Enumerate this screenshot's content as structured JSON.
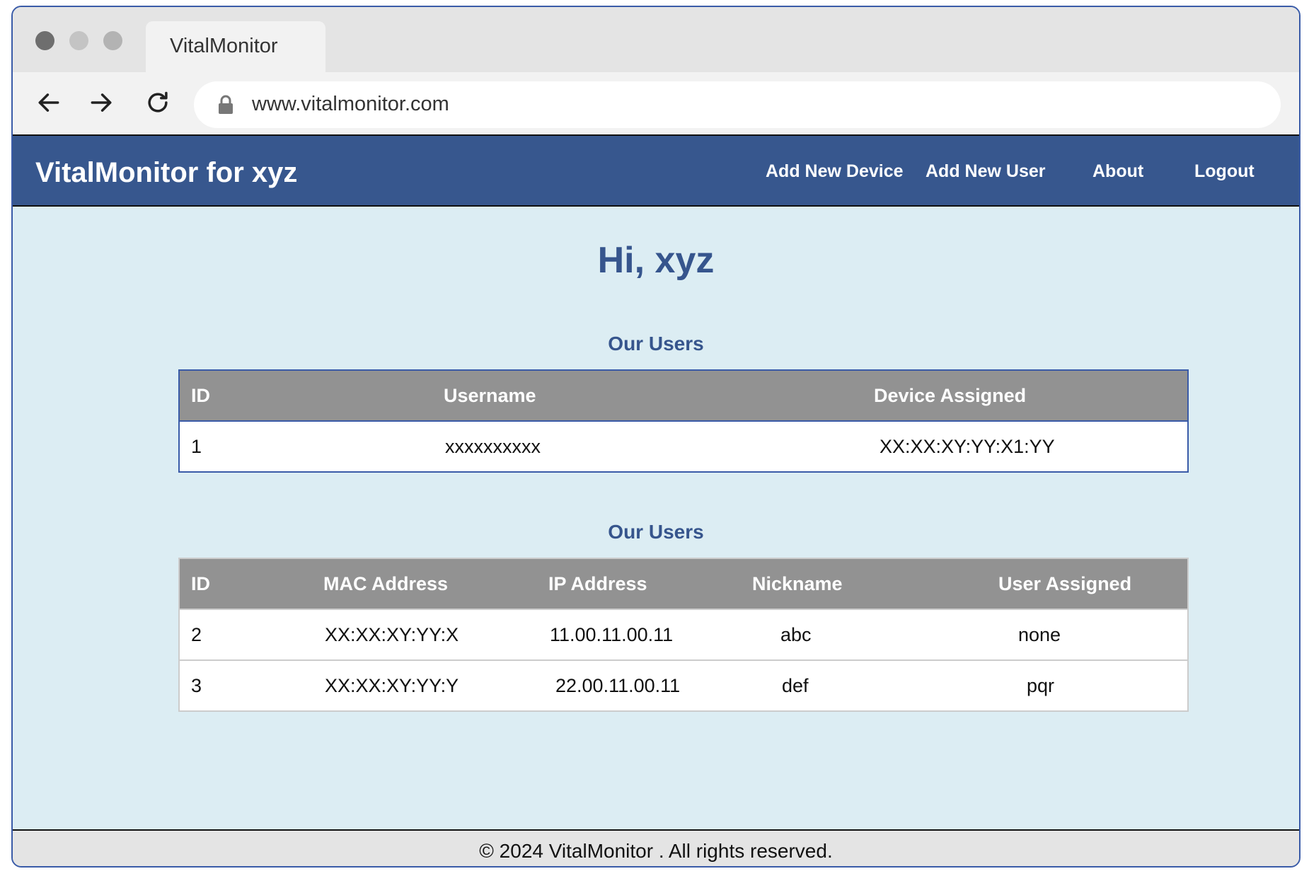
{
  "browser": {
    "tab_title": "VitalMonitor",
    "url": "www.vitalmonitor.com"
  },
  "header": {
    "brand": "VitalMonitor for xyz",
    "nav": {
      "add_device": "Add New Device",
      "add_user": "Add New User",
      "about": "About",
      "logout": "Logout"
    }
  },
  "main": {
    "greeting": "Hi, xyz",
    "users_section": {
      "title": "Our Users",
      "columns": [
        "ID",
        "Username",
        "Device Assigned"
      ],
      "rows": [
        [
          "1",
          "xxxxxxxxxx",
          "XX:XX:XY:YY:X1:YY"
        ]
      ]
    },
    "devices_section": {
      "title": "Our Users",
      "columns": [
        "ID",
        "MAC Address",
        "IP Address",
        "Nickname",
        "User Assigned"
      ],
      "rows": [
        [
          "2",
          "XX:XX:XY:YY:X",
          "11.00.11.00.11",
          "abc",
          "none"
        ],
        [
          "3",
          "XX:XX:XY:YY:Y",
          "22.00.11.00.11",
          "def",
          "pqr"
        ]
      ]
    }
  },
  "footer": {
    "text": "© 2024 VitalMonitor . All rights reserved."
  },
  "colors": {
    "header_bg": "#37578e",
    "accent_text": "#36558d",
    "content_bg": "#dcedf3",
    "table_header_bg": "#929292"
  }
}
